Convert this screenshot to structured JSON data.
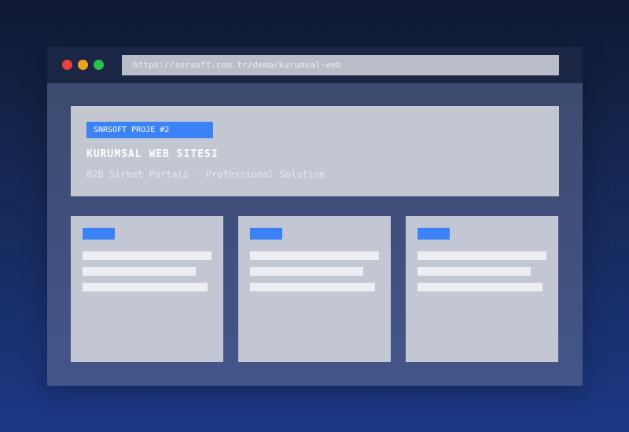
{
  "browser": {
    "url": "https://snrsoft.com.tr/demo/kurumsal-web"
  },
  "hero": {
    "badge": "SNRSOFT PROJE #2",
    "title": "KURUMSAL WEB SITESI",
    "subtitle": "B2B Sirket Portali - Professional Solution"
  },
  "colors": {
    "accent": "#3b82f6",
    "close_dot": "#e8413e",
    "minimize_dot": "#f2a022",
    "maximize_dot": "#27c24a"
  }
}
